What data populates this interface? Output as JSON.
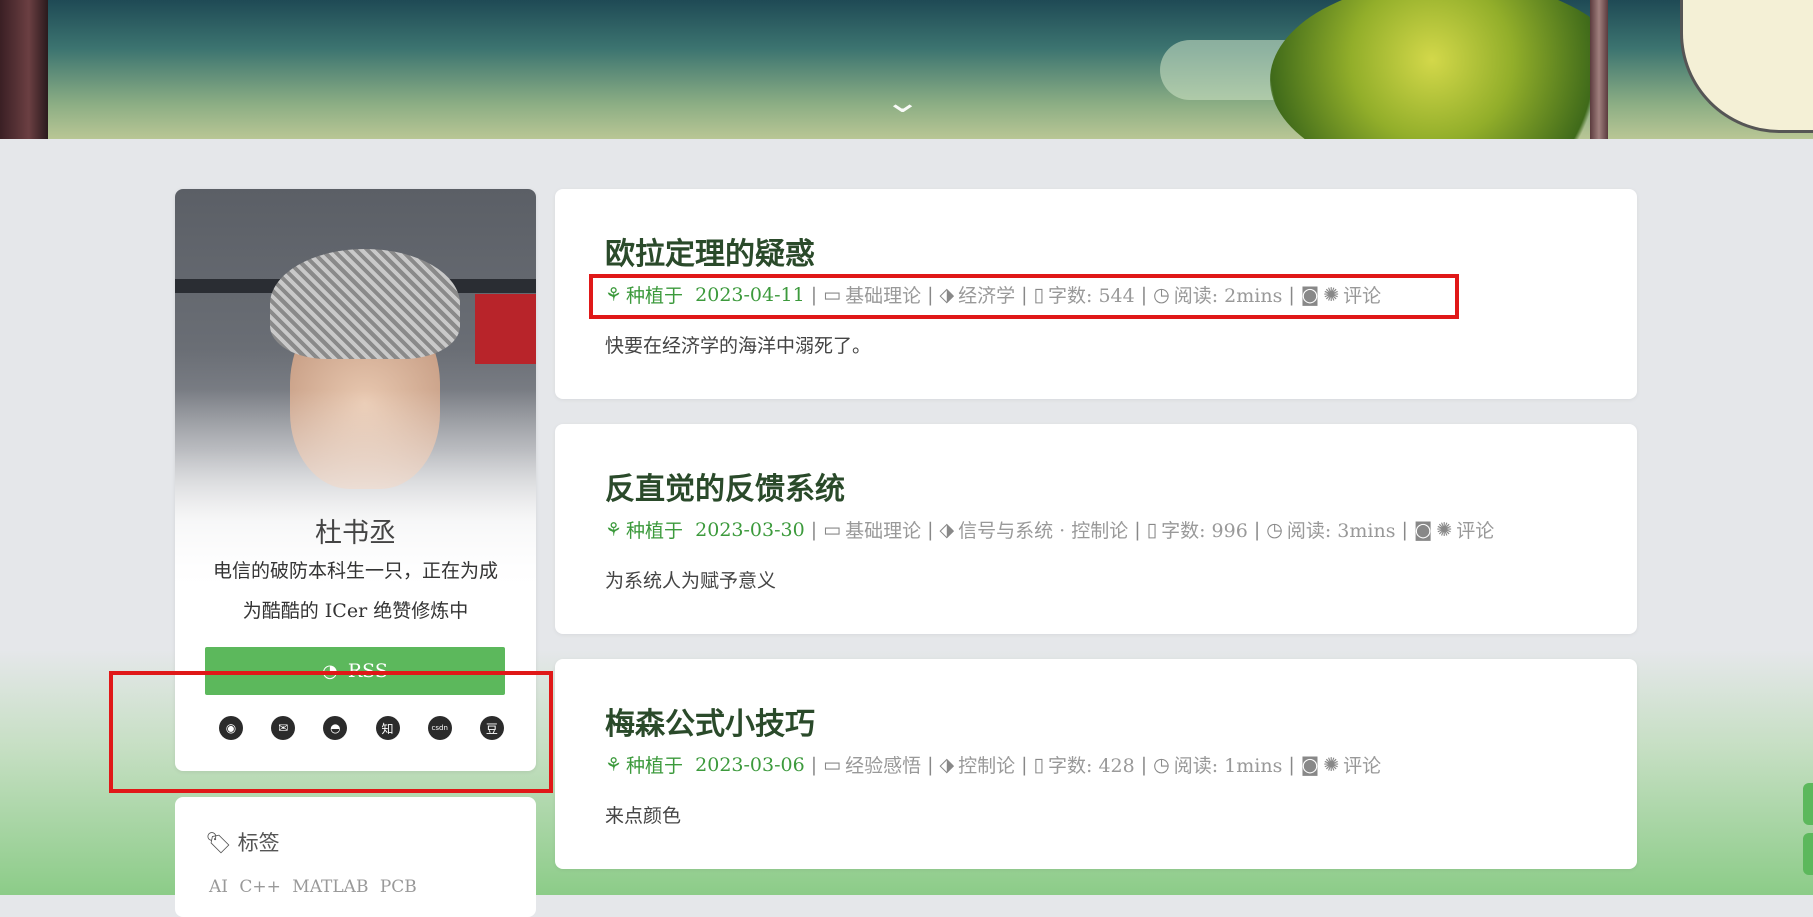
{
  "profile": {
    "name": "杜书丞",
    "desc_line1": "电信的破防本科生一只，正在为成",
    "desc_line2": "为酷酷的 ICer 绝赞修炼中",
    "rss_label": "RSS",
    "socials": [
      {
        "icon": "github-icon",
        "glyph": "◉"
      },
      {
        "icon": "email-icon",
        "glyph": "✉"
      },
      {
        "icon": "qq-icon",
        "glyph": "◓"
      },
      {
        "icon": "zhihu-icon",
        "glyph": "知"
      },
      {
        "icon": "csdn-icon",
        "glyph": "csdn"
      },
      {
        "icon": "douban-icon",
        "glyph": "豆"
      }
    ]
  },
  "tags": {
    "heading": "标签",
    "items": "AI C++ MATLAB PCB"
  },
  "posts": [
    {
      "title": "欧拉定理的疑惑",
      "planted_label": "种植于",
      "date": "2023-04-11",
      "category": "基础理论",
      "tags_text": "经济学",
      "wordcount": "字数: 544",
      "readtime": "阅读: 2mins",
      "comments": "评论",
      "excerpt": "快要在经济学的海洋中溺死了。"
    },
    {
      "title": "反直觉的反馈系统",
      "planted_label": "种植于",
      "date": "2023-03-30",
      "category": "基础理论",
      "tags_text": "信号与系统 · 控制论",
      "wordcount": "字数: 996",
      "readtime": "阅读: 3mins",
      "comments": "评论",
      "excerpt": "为系统人为赋予意义"
    },
    {
      "title": "梅森公式小技巧",
      "planted_label": "种植于",
      "date": "2023-03-06",
      "category": "经验感悟",
      "tags_text": "控制论",
      "wordcount": "字数: 428",
      "readtime": "阅读: 1mins",
      "comments": "评论",
      "excerpt": "来点颜色"
    }
  ],
  "colors": {
    "accent_green": "#5cb85c",
    "highlight_red": "#e01818"
  }
}
